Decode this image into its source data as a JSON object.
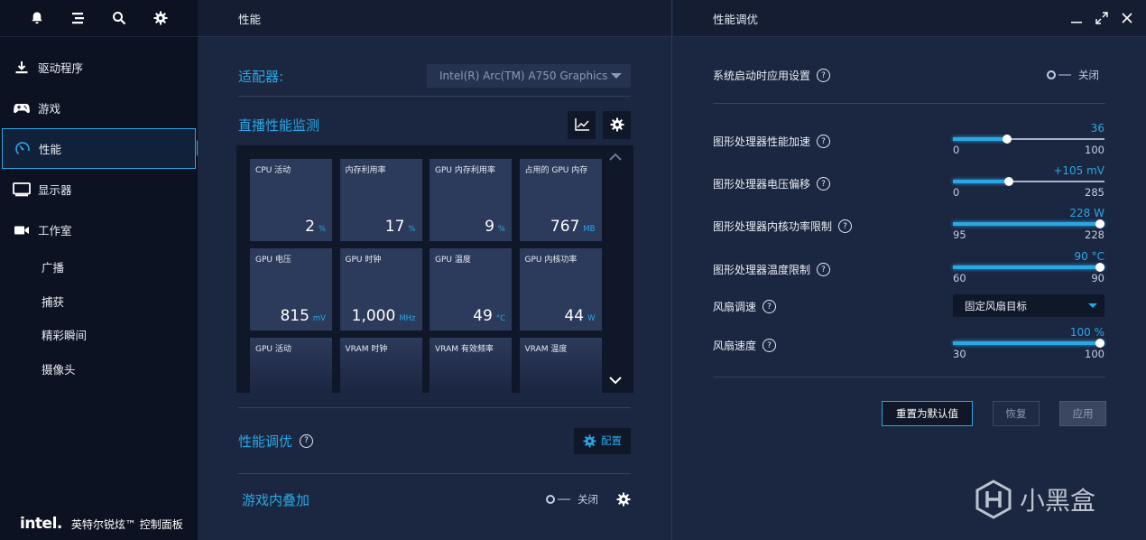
{
  "sidebar": {
    "top_icons": [
      "bell-icon",
      "menu-icon",
      "search-icon",
      "gear-icon"
    ],
    "items": [
      {
        "label": "驱动程序",
        "icon": "download-icon"
      },
      {
        "label": "游戏",
        "icon": "gamepad-icon"
      },
      {
        "label": "性能",
        "icon": "gauge-icon",
        "active": true
      },
      {
        "label": "显示器",
        "icon": "monitor-icon"
      },
      {
        "label": "工作室",
        "icon": "camera-icon"
      }
    ],
    "sub_items": [
      "广播",
      "捕获",
      "精彩瞬间",
      "摄像头"
    ],
    "brand": {
      "logo": "intel.",
      "name": "英特尔锐炫™ 控制面板"
    }
  },
  "performance": {
    "header": "性能",
    "adapter_label": "适配器:",
    "adapter_value": "Intel(R) Arc(TM) A750 Graphics",
    "monitor_title": "直播性能监测",
    "tiles": [
      {
        "label": "CPU 活动",
        "value": "2",
        "unit": "%"
      },
      {
        "label": "内存利用率",
        "value": "17",
        "unit": "%"
      },
      {
        "label": "GPU 内存利用率",
        "value": "9",
        "unit": "%"
      },
      {
        "label": "占用的 GPU 内存",
        "value": "767",
        "unit": "MB"
      },
      {
        "label": "GPU 电压",
        "value": "815",
        "unit": "mV"
      },
      {
        "label": "GPU 时钟",
        "value": "1,000",
        "unit": "MHz"
      },
      {
        "label": "GPU 温度",
        "value": "49",
        "unit": "°C"
      },
      {
        "label": "GPU 内核功率",
        "value": "44",
        "unit": "W"
      },
      {
        "label": "GPU 活动",
        "value": "",
        "unit": ""
      },
      {
        "label": "VRAM 时钟",
        "value": "",
        "unit": ""
      },
      {
        "label": "VRAM 有效频率",
        "value": "",
        "unit": ""
      },
      {
        "label": "VRAM 温度",
        "value": "",
        "unit": ""
      }
    ],
    "tuning_title": "性能调优",
    "config_label": "配置",
    "overlay_title": "游戏内叠加",
    "overlay_state": "关闭"
  },
  "tuning": {
    "header": "性能调优",
    "startup_label": "系统启动时应用设置",
    "startup_state": "关闭",
    "sliders": [
      {
        "label": "图形处理器性能加速",
        "value": "36",
        "min": "0",
        "max": "100",
        "fraction": 0.36
      },
      {
        "label": "图形处理器电压偏移",
        "value": "+105 mV",
        "min": "0",
        "max": "285",
        "fraction": 0.368
      },
      {
        "label": "图形处理器内核功率限制",
        "value": "228 W",
        "min": "95",
        "max": "228",
        "fraction": 1.0
      },
      {
        "label": "图形处理器温度限制",
        "value": "90 °C",
        "min": "60",
        "max": "90",
        "fraction": 1.0
      }
    ],
    "fan_mode_label": "风扇调速",
    "fan_mode_value": "固定风扇目标",
    "fan_speed": {
      "label": "风扇速度",
      "value": "100 %",
      "min": "30",
      "max": "100",
      "fraction": 1.0
    },
    "buttons": {
      "reset": "重置为默认值",
      "restore": "恢复",
      "apply": "应用"
    }
  },
  "watermark": "小黑盒",
  "colors": {
    "accent": "#2aa8e6",
    "sidebar_bg": "#0c1221",
    "panel_bg": "#1b2640",
    "tile_bg": "#2c3a5b"
  }
}
